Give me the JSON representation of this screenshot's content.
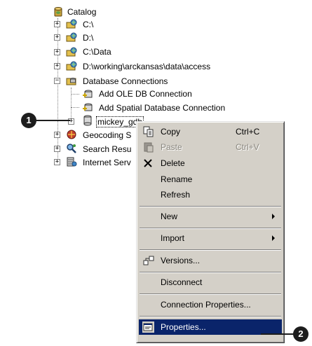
{
  "tree": {
    "items": [
      {
        "label": "Catalog",
        "icon": "catalog-globe-icon"
      },
      {
        "label": "C:\\",
        "icon": "drive-folder-icon"
      },
      {
        "label": "D:\\",
        "icon": "drive-folder-icon"
      },
      {
        "label": "C:\\Data",
        "icon": "drive-folder-icon"
      },
      {
        "label": "D:\\working\\arckansas\\data\\access",
        "icon": "drive-folder-icon"
      },
      {
        "label": "Database Connections",
        "icon": "database-connections-icon"
      },
      {
        "label": "Add OLE DB Connection",
        "icon": "add-connection-icon"
      },
      {
        "label": "Add Spatial Database Connection",
        "icon": "add-connection-icon"
      },
      {
        "label": "mickey_gdb",
        "icon": "geodatabase-icon"
      },
      {
        "label": "Geocoding S",
        "icon": "geocoding-icon"
      },
      {
        "label": "Search Resu",
        "icon": "search-results-icon"
      },
      {
        "label": "Internet Serv",
        "icon": "internet-servers-icon"
      }
    ]
  },
  "context_menu": {
    "items": [
      {
        "label": "Copy",
        "shortcut": "Ctrl+C",
        "icon": "copy-icon",
        "enabled": true
      },
      {
        "label": "Paste",
        "shortcut": "Ctrl+V",
        "icon": "paste-icon",
        "enabled": false
      },
      {
        "label": "Delete",
        "icon": "delete-x-icon",
        "enabled": true
      },
      {
        "label": "Rename",
        "enabled": true
      },
      {
        "label": "Refresh",
        "enabled": true
      },
      {
        "label": "New",
        "submenu": true,
        "enabled": true
      },
      {
        "label": "Import",
        "submenu": true,
        "enabled": true
      },
      {
        "label": "Versions...",
        "icon": "versions-icon",
        "enabled": true
      },
      {
        "label": "Disconnect",
        "enabled": true
      },
      {
        "label": "Connection Properties...",
        "enabled": true
      },
      {
        "label": "Properties...",
        "icon": "properties-icon",
        "enabled": true,
        "highlighted": true
      }
    ]
  },
  "callouts": {
    "step1": "1",
    "step2": "2"
  },
  "colors": {
    "menu_bg": "#d4d0c8",
    "highlight": "#0a246a",
    "callout": "#1d1d1d"
  }
}
